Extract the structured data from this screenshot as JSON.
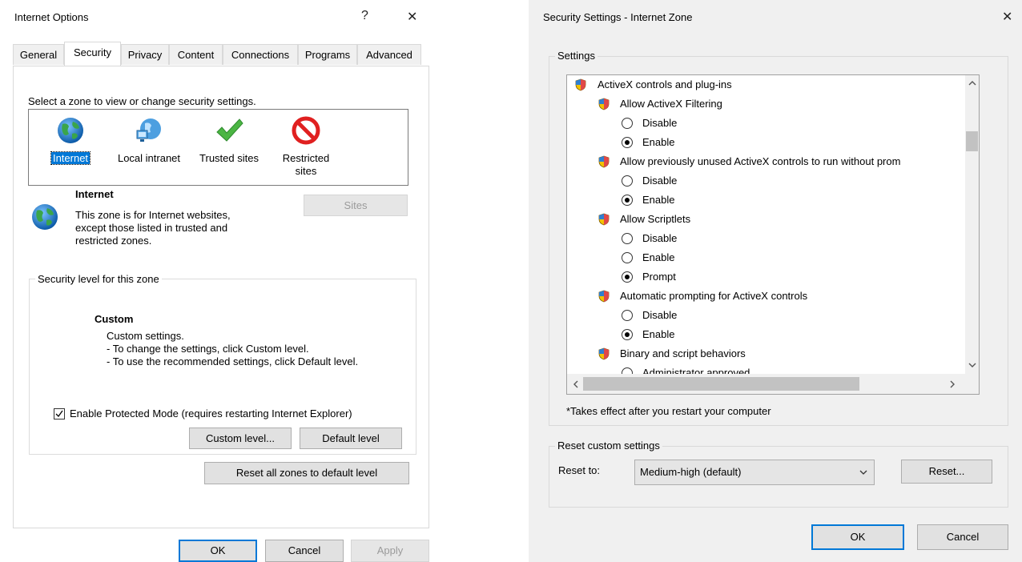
{
  "left_dialog": {
    "title": "Internet Options",
    "help_glyph": "?",
    "close_glyph": "✕",
    "tabs": [
      "General",
      "Security",
      "Privacy",
      "Content",
      "Connections",
      "Programs",
      "Advanced"
    ],
    "active_tab": "Security",
    "zone_prompt": "Select a zone to view or change security settings.",
    "zones": [
      {
        "label": "Internet",
        "icon": "globe-icon",
        "selected": true
      },
      {
        "label": "Local intranet",
        "icon": "intranet-icon",
        "selected": false
      },
      {
        "label": "Trusted sites",
        "icon": "checkmark-icon",
        "selected": false
      },
      {
        "label_line1": "Restricted",
        "label_line2": "sites",
        "icon": "restricted-icon",
        "selected": false
      }
    ],
    "zone_info": {
      "name": "Internet",
      "description_line1": "This zone is for Internet websites,",
      "description_line2": "except those listed in trusted and",
      "description_line3": "restricted zones."
    },
    "sites_button": "Sites",
    "security_level_legend": "Security level for this zone",
    "security_level": {
      "name": "Custom",
      "line1": "Custom settings.",
      "line2": "- To change the settings, click Custom level.",
      "line3": "- To use the recommended settings, click Default level."
    },
    "protected_mode_label": "Enable Protected Mode (requires restarting Internet Explorer)",
    "protected_mode_checked": true,
    "custom_level_button": "Custom level...",
    "default_level_button": "Default level",
    "reset_all_button": "Reset all zones to default level",
    "ok_button": "OK",
    "cancel_button": "Cancel",
    "apply_button": "Apply"
  },
  "right_dialog": {
    "title": "Security Settings - Internet Zone",
    "close_glyph": "✕",
    "settings_legend": "Settings",
    "settings_items": [
      {
        "kind": "category",
        "label": "ActiveX controls and plug-ins"
      },
      {
        "kind": "setting",
        "label": "Allow ActiveX Filtering"
      },
      {
        "kind": "option",
        "label": "Disable",
        "checked": false
      },
      {
        "kind": "option",
        "label": "Enable",
        "checked": true
      },
      {
        "kind": "setting",
        "label": "Allow previously unused ActiveX controls to run without prom"
      },
      {
        "kind": "option",
        "label": "Disable",
        "checked": false
      },
      {
        "kind": "option",
        "label": "Enable",
        "checked": true
      },
      {
        "kind": "setting",
        "label": "Allow Scriptlets"
      },
      {
        "kind": "option",
        "label": "Disable",
        "checked": false
      },
      {
        "kind": "option",
        "label": "Enable",
        "checked": false
      },
      {
        "kind": "option",
        "label": "Prompt",
        "checked": true
      },
      {
        "kind": "setting",
        "label": "Automatic prompting for ActiveX controls"
      },
      {
        "kind": "option",
        "label": "Disable",
        "checked": false
      },
      {
        "kind": "option",
        "label": "Enable",
        "checked": true
      },
      {
        "kind": "setting",
        "label": "Binary and script behaviors"
      },
      {
        "kind": "option",
        "label": "Administrator approved",
        "checked": false
      }
    ],
    "restart_note": "*Takes effect after you restart your computer",
    "reset_legend": "Reset custom settings",
    "reset_to_label": "Reset to:",
    "reset_to_value": "Medium-high (default)",
    "reset_button": "Reset...",
    "ok_button": "OK",
    "cancel_button": "Cancel"
  },
  "colors": {
    "accent": "#0078d7",
    "dialog_bg": "#f0f0f0",
    "button_bg": "#e1e1e1"
  }
}
